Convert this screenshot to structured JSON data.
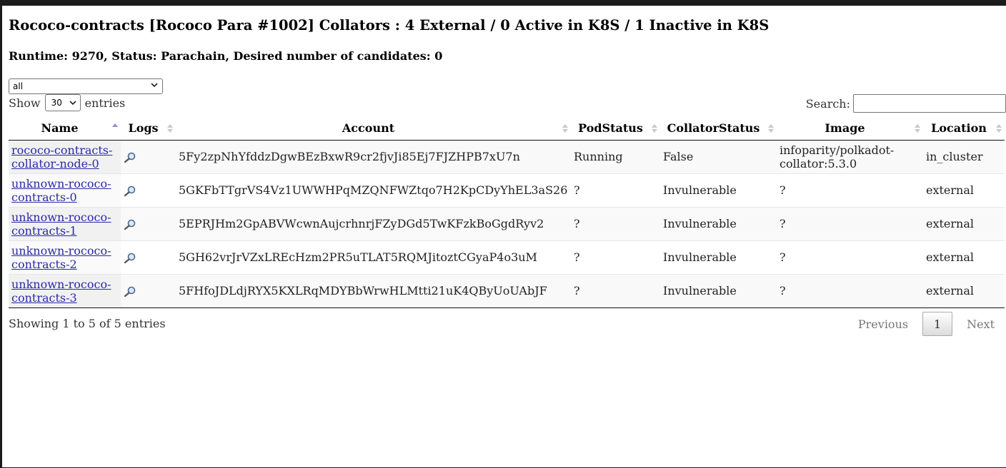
{
  "header": {
    "title": "Rococo-contracts [Rococo Para #1002] Collators : 4 External / 0 Active in K8S / 1 Inactive in K8S",
    "subtitle": "Runtime: 9270, Status: Parachain, Desired number of candidates: 0"
  },
  "filter": {
    "selected": "all"
  },
  "length": {
    "prefix": "Show",
    "selected": "30",
    "suffix": "entries"
  },
  "search": {
    "label": "Search:",
    "value": ""
  },
  "table": {
    "columns": [
      "Name",
      "Logs",
      "Account",
      "PodStatus",
      "CollatorStatus",
      "Image",
      "Location"
    ],
    "sorted_column": "Name",
    "sort_direction": "asc",
    "rows": [
      {
        "name": "rococo-contracts-collator-node-0",
        "account": "5Fy2zpNhYfddzDgwBEzBxwR9cr2fjvJi85Ej7FJZHPB7xU7n",
        "pod_status": "Running",
        "collator_status": "False",
        "image": "infoparity/polkadot-collator:5.3.0",
        "location": "in_cluster"
      },
      {
        "name": "unknown-rococo-contracts-0",
        "account": "5GKFbTTgrVS4Vz1UWWHPqMZQNFWZtqo7H2KpCDyYhEL3aS26",
        "pod_status": "?",
        "collator_status": "Invulnerable",
        "image": "?",
        "location": "external"
      },
      {
        "name": "unknown-rococo-contracts-1",
        "account": "5EPRJHm2GpABVWcwnAujcrhnrjFZyDGd5TwKFzkBoGgdRyv2",
        "pod_status": "?",
        "collator_status": "Invulnerable",
        "image": "?",
        "location": "external"
      },
      {
        "name": "unknown-rococo-contracts-2",
        "account": "5GH62vrJrVZxLREcHzm2PR5uTLAT5RQMJitoztCGyaP4o3uM",
        "pod_status": "?",
        "collator_status": "Invulnerable",
        "image": "?",
        "location": "external"
      },
      {
        "name": "unknown-rococo-contracts-3",
        "account": "5FHfoJDLdjRYX5KXLRqMDYBbWrwHLMtti21uK4QByUoUAbJF",
        "pod_status": "?",
        "collator_status": "Invulnerable",
        "image": "?",
        "location": "external"
      }
    ]
  },
  "info": "Showing 1 to 5 of 5 entries",
  "pagination": {
    "previous": "Previous",
    "current": "1",
    "next": "Next"
  },
  "icons": {
    "logs": "magnifier-icon",
    "sort": "sort-arrows-icon",
    "dropdown": "chevron-down-icon"
  }
}
